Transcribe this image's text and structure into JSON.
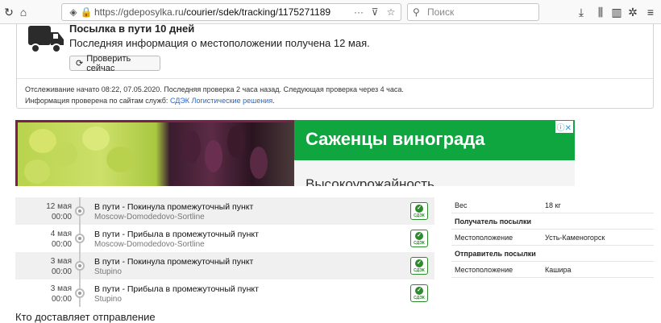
{
  "browser": {
    "url_host": "https://gdeposylka.ru",
    "url_path": "/courier/sdek/tracking/1175271189",
    "search_placeholder": "Поиск"
  },
  "status": {
    "title": "Посылка в пути 10 дней",
    "subtitle": "Последняя информация о местоположении получена 12 мая.",
    "check_button": "Проверить сейчас",
    "tracking_info": "Отслеживание начато 08:22, 07.05.2020. Последняя проверка 2 часа назад. Следующая проверка через 4 часа.",
    "checked_prefix": "Информация проверена по сайтам служб:",
    "checked_link": "СДЭК Логистические решения",
    "checked_suffix": "."
  },
  "ad": {
    "headline": "Саженцы винограда",
    "subline": "Высокоурожайность"
  },
  "timeline": [
    {
      "date": "12 мая",
      "time": "00:00",
      "title": "В пути - Покинула промежуточный пункт",
      "place": "Moscow-Domodedovo-Sortline"
    },
    {
      "date": "4 мая",
      "time": "00:00",
      "title": "В пути - Прибыла в промежуточный пункт",
      "place": "Moscow-Domodedovo-Sortline"
    },
    {
      "date": "3 мая",
      "time": "00:00",
      "title": "В пути - Покинула промежуточный пункт",
      "place": "Stupino"
    },
    {
      "date": "3 мая",
      "time": "00:00",
      "title": "В пути - Прибыла в промежуточный пункт",
      "place": "Stupino"
    }
  ],
  "carrier_logo_text": "СДЭК",
  "details": {
    "weight_label": "Вес",
    "weight_value": "18 кг",
    "recipient_heading": "Получатель посылки",
    "recipient_location_label": "Местоположение",
    "recipient_location_value": "Усть-Каменогорск",
    "sender_heading": "Отправитель посылки",
    "sender_location_label": "Местоположение",
    "sender_location_value": "Кашира"
  },
  "footer_text": "Кто доставляет отправление"
}
